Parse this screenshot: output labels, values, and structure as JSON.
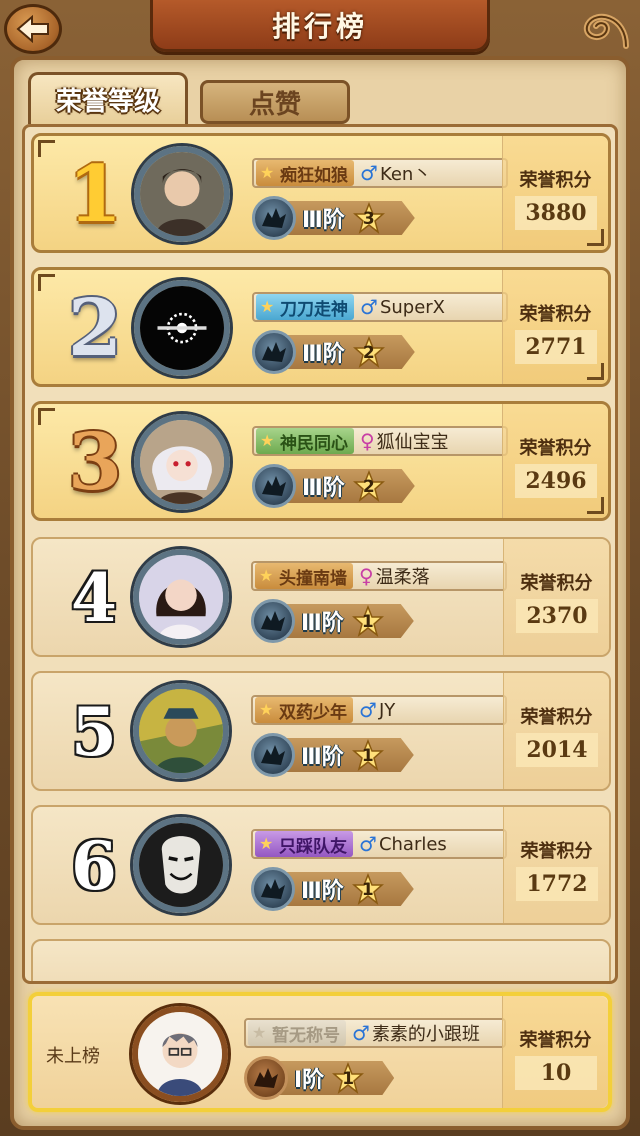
{
  "header": {
    "title": "排行榜",
    "back_icon": "back-arrow-icon",
    "corner_icon": "swirl-ornament-icon"
  },
  "tabs": [
    {
      "label": "荣誉等级",
      "active": true
    },
    {
      "label": "点赞",
      "active": false
    }
  ],
  "score_label": "荣誉积分",
  "rankings": [
    {
      "rank": "1",
      "medal": "gold",
      "title": "痴狂如狼",
      "title_color": "orange",
      "gender": "male",
      "gender_symbol": "♂",
      "name": "Ken丶",
      "level": "Ⅲ阶",
      "stars": "3",
      "score": "3880",
      "avatar": "boy-photo"
    },
    {
      "rank": "2",
      "medal": "silver",
      "title": "刀刀走神",
      "title_color": "blue",
      "gender": "male",
      "gender_symbol": "♂",
      "name": "SuperX",
      "level": "Ⅲ阶",
      "stars": "2",
      "score": "2771",
      "avatar": "black-logo"
    },
    {
      "rank": "3",
      "medal": "bronze",
      "title": "神民同心",
      "title_color": "green",
      "gender": "female",
      "gender_symbol": "♀",
      "name": "狐仙宝宝",
      "level": "Ⅲ阶",
      "stars": "2",
      "score": "2496",
      "avatar": "anime-white-hair"
    },
    {
      "rank": "4",
      "medal": "plain",
      "title": "头撞南墙",
      "title_color": "orange",
      "gender": "female",
      "gender_symbol": "♀",
      "name": "温柔落",
      "level": "Ⅲ阶",
      "stars": "1",
      "score": "2370",
      "avatar": "girl-photo"
    },
    {
      "rank": "5",
      "medal": "plain",
      "title": "双药少年",
      "title_color": "orange",
      "gender": "male",
      "gender_symbol": "♂",
      "name": "JY",
      "level": "Ⅲ阶",
      "stars": "1",
      "score": "2014",
      "avatar": "painting-portrait"
    },
    {
      "rank": "6",
      "medal": "plain",
      "title": "只踩队友",
      "title_color": "purple",
      "gender": "male",
      "gender_symbol": "♂",
      "name": "Charles",
      "level": "Ⅲ阶",
      "stars": "1",
      "score": "1772",
      "avatar": "mask-face"
    }
  ],
  "my_rank": {
    "status": "未上榜",
    "title": "暂无称号",
    "gender": "male",
    "gender_symbol": "♂",
    "name": "素素的小跟班",
    "level": "Ⅰ阶",
    "stars": "1",
    "score": "10",
    "avatar": "cartoon-boy"
  },
  "colors": {
    "wood": "#6e4c29",
    "parchment": "#f1dfba",
    "gold_highlight": "#f3cf3a"
  }
}
